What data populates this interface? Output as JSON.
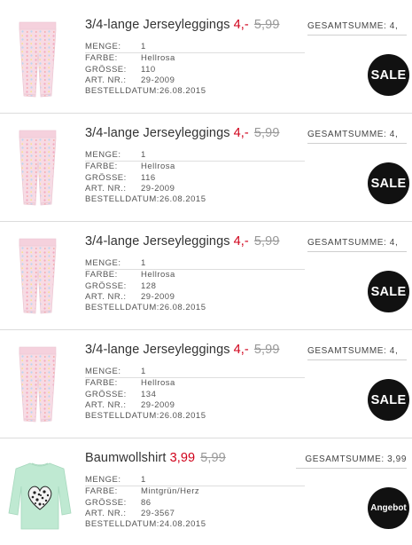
{
  "colors": {
    "sale_price": "#d0021b",
    "old_price": "#999999",
    "badge": "#111111"
  },
  "labels": {
    "quantity": "MENGE:",
    "color": "FARBE:",
    "size": "GRÖSSE:",
    "article": "ART. NR.:",
    "order_date": "BESTELLDATUM:"
  },
  "items": [
    {
      "name": "3/4-lange Jerseyleggings",
      "price_new": "4,-",
      "price_old": "5,99",
      "total": "GESAMTSUMME: 4,",
      "quantity": "1",
      "color": "Hellrosa",
      "size": "110",
      "article": "29-2009",
      "order_date": "26.08.2015",
      "badge": "SALE",
      "image": "pink-leggings-image"
    },
    {
      "name": "3/4-lange Jerseyleggings",
      "price_new": "4,-",
      "price_old": "5,99",
      "total": "GESAMTSUMME: 4,",
      "quantity": "1",
      "color": "Hellrosa",
      "size": "116",
      "article": "29-2009",
      "order_date": "26.08.2015",
      "badge": "SALE",
      "image": "pink-leggings-image"
    },
    {
      "name": "3/4-lange Jerseyleggings",
      "price_new": "4,-",
      "price_old": "5,99",
      "total": "GESAMTSUMME: 4,",
      "quantity": "1",
      "color": "Hellrosa",
      "size": "128",
      "article": "29-2009",
      "order_date": "26.08.2015",
      "badge": "SALE",
      "image": "pink-leggings-image"
    },
    {
      "name": "3/4-lange Jerseyleggings",
      "price_new": "4,-",
      "price_old": "5,99",
      "total": "GESAMTSUMME: 4,",
      "quantity": "1",
      "color": "Hellrosa",
      "size": "134",
      "article": "29-2009",
      "order_date": "26.08.2015",
      "badge": "SALE",
      "image": "pink-leggings-image"
    },
    {
      "name": "Baumwollshirt",
      "price_new": "3,99",
      "price_old": "5,99",
      "total": "GESAMTSUMME: 3,99",
      "quantity": "1",
      "color": "Mintgrün/Herz",
      "size": "86",
      "article": "29-3567",
      "order_date": "24.08.2015",
      "badge": "Angebot",
      "image": "mint-shirt-image"
    }
  ]
}
